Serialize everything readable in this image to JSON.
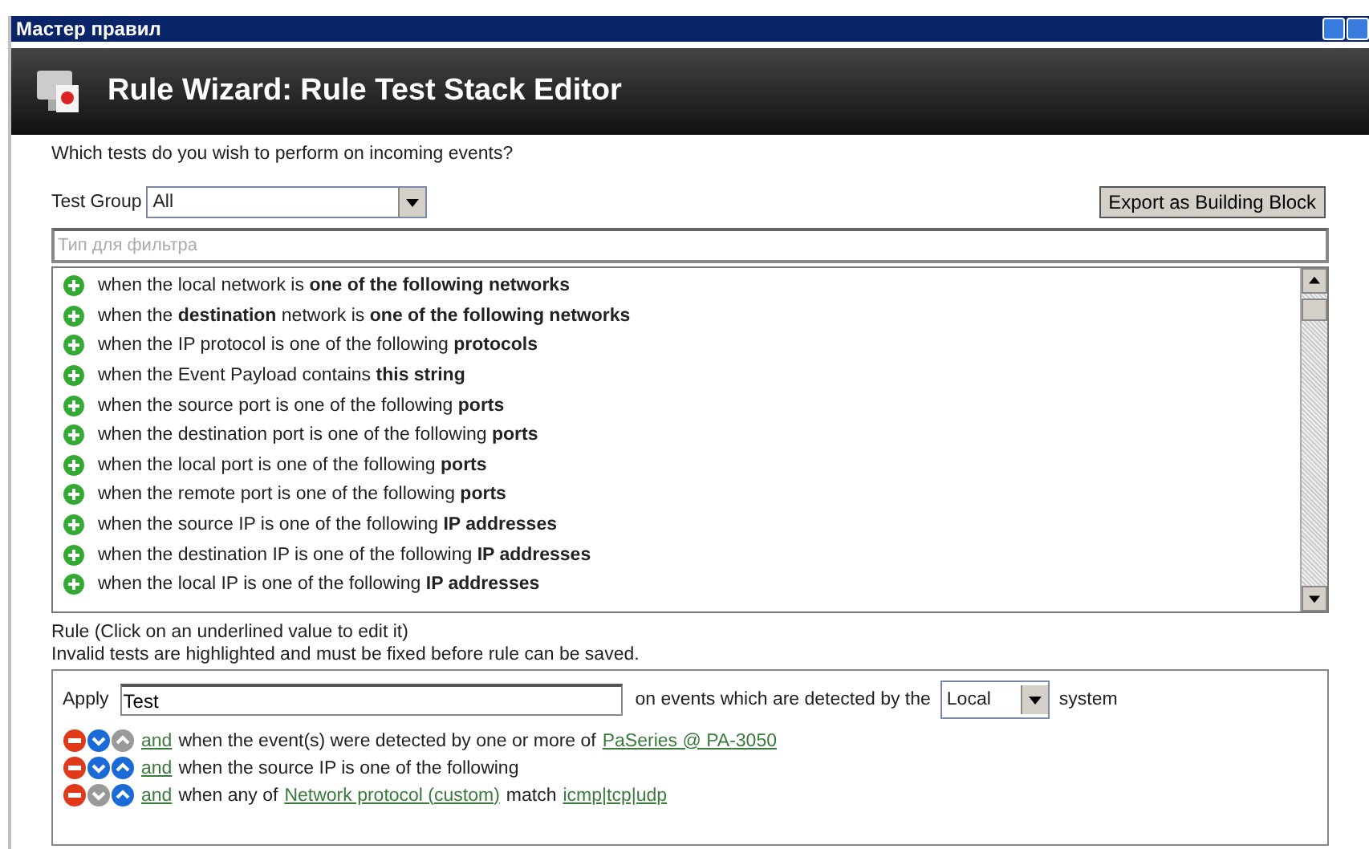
{
  "window": {
    "title": "Мастер правил"
  },
  "header": {
    "title": "Rule Wizard: Rule Test Stack Editor"
  },
  "question": "Which tests do you wish to perform on incoming events?",
  "test_group": {
    "label": "Test Group",
    "value": "All"
  },
  "export_button": "Export as Building Block",
  "filter": {
    "placeholder": "Тип для фильтра"
  },
  "tests": [
    "when the local network is **one of the following networks**",
    "when the **destination** network is **one of the following networks**",
    "when the IP protocol is one of the following **protocols**",
    "when the Event Payload contains **this string**",
    "when the source port is one of the following **ports**",
    "when the destination port is one of the following **ports**",
    "when the local port is one of the following **ports**",
    "when the remote port is one of the following **ports**",
    "when the source IP is one of the following **IP addresses**",
    "when the destination IP is one of the following **IP addresses**",
    "when the local IP is one of the following **IP addresses**"
  ],
  "rule_hint": [
    "Rule (Click on an underlined value to edit it)",
    "Invalid tests are highlighted and must be fixed before rule can be saved."
  ],
  "rule": {
    "apply_label": "Apply",
    "name": "Test",
    "middle": "on events which are detected by the",
    "system": "Local",
    "suffix": "system",
    "tests": [
      {
        "can_move_down": true,
        "can_move_up": false,
        "parts": [
          {
            "kind": "link",
            "text": "and"
          },
          {
            "kind": "plain",
            "text": "when the event(s) were detected by one or more of"
          },
          {
            "kind": "link",
            "text": "PaSeries @ PA-3050"
          }
        ]
      },
      {
        "can_move_down": true,
        "can_move_up": true,
        "parts": [
          {
            "kind": "link",
            "text": "and"
          },
          {
            "kind": "plain",
            "text": "when the source IP is one of the following"
          }
        ]
      },
      {
        "can_move_down": false,
        "can_move_up": true,
        "parts": [
          {
            "kind": "link",
            "text": "and"
          },
          {
            "kind": "plain",
            "text": "when any of"
          },
          {
            "kind": "link",
            "text": "Network protocol (custom)"
          },
          {
            "kind": "plain",
            "text": "match"
          },
          {
            "kind": "link",
            "text": "icmp|tcp|udp"
          }
        ]
      }
    ]
  }
}
